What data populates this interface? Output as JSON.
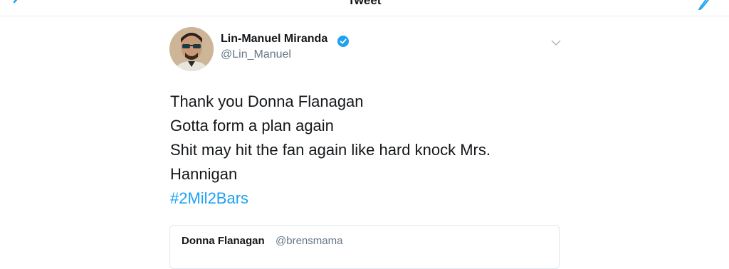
{
  "header": {
    "title": "Tweet",
    "back_icon": "chevron-left-icon",
    "compose_icon": "compose-icon"
  },
  "tweet": {
    "author_name": "Lin-Manuel Miranda",
    "verified_icon": "verified-badge-icon",
    "handle": "@Lin_Manuel",
    "menu_icon": "chevron-down-icon",
    "lines": [
      "Thank you Donna Flanagan",
      "Gotta form a plan again",
      "Shit may hit the fan again like hard knock Mrs.",
      "Hannigan"
    ],
    "hashtag": "#2Mil2Bars"
  },
  "quoted_tweet": {
    "name": "Donna Flanagan",
    "handle": "@brensmama"
  },
  "colors": {
    "accent": "#1da1f2",
    "text": "#14171a",
    "secondary_text": "#657786",
    "divider": "#e6ecf0"
  }
}
